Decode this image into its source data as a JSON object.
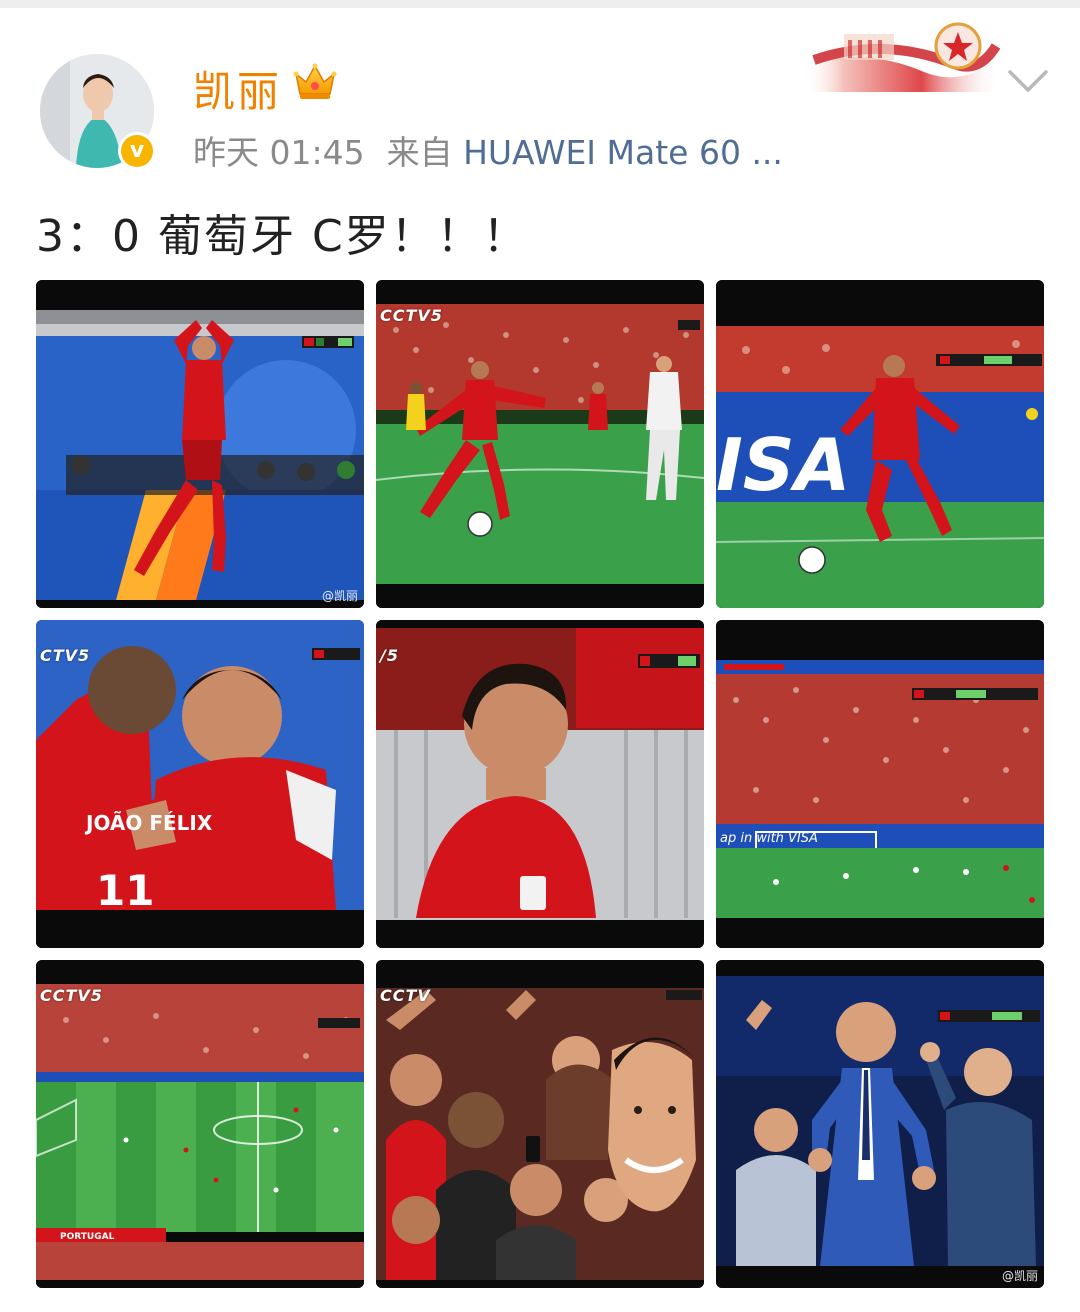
{
  "user": {
    "name": "凯丽",
    "verified_mark": "v"
  },
  "post": {
    "time": "昨天 01:45",
    "source_prefix": "来自",
    "source_name": "HUAWEI Mate 60 ...",
    "text": "3：0  葡萄牙  C罗！！！"
  },
  "images": [
    {
      "desc": "ronaldo-celebration",
      "tv_logo": "",
      "watermark": "@凯丽"
    },
    {
      "desc": "ronaldo-dribbling",
      "tv_logo": "CCTV5",
      "watermark": ""
    },
    {
      "desc": "ronaldo-running-visa-board",
      "tv_logo": "",
      "watermark": ""
    },
    {
      "desc": "ronaldo-hug",
      "tv_logo": "CTV5",
      "watermark": ""
    },
    {
      "desc": "ronaldo-smiling",
      "tv_logo": "/5",
      "watermark": ""
    },
    {
      "desc": "stadium-goal-view",
      "tv_logo": "",
      "watermark": ""
    },
    {
      "desc": "stadium-wide-pitch",
      "tv_logo": "CCTV5",
      "watermark": ""
    },
    {
      "desc": "fans-with-ronaldo-mask",
      "tv_logo": "CCTV",
      "watermark": ""
    },
    {
      "desc": "coach-celebrating",
      "tv_logo": "",
      "watermark": "@凯丽"
    }
  ],
  "icons": {
    "crown": "crown-icon",
    "dropdown": "chevron-down-icon",
    "banner": "national-emblem-banner"
  },
  "colors": {
    "username": "#f08200",
    "source": "#4f6d95",
    "meta": "#8a8a8a",
    "verified": "#f7b500"
  }
}
